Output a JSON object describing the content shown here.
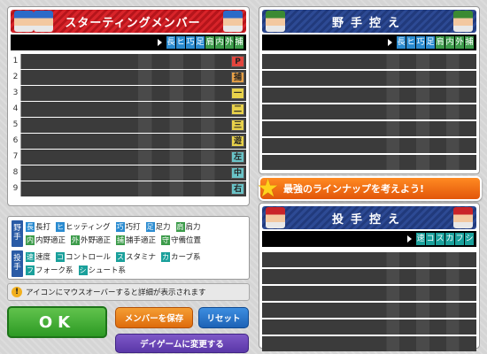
{
  "starting": {
    "title": "スターティングメンバー",
    "ability_icons": [
      {
        "label": "長",
        "color": "#2a8bd0"
      },
      {
        "label": "ヒ",
        "color": "#2a8bd0"
      },
      {
        "label": "巧",
        "color": "#2a8bd0"
      },
      {
        "label": "足",
        "color": "#2a8bd0"
      },
      {
        "label": "肩",
        "color": "#3c9b4a"
      },
      {
        "label": "内",
        "color": "#3c9b4a"
      },
      {
        "label": "外",
        "color": "#3c9b4a"
      },
      {
        "label": "捕",
        "color": "#3c9b4a"
      }
    ],
    "lineup": [
      {
        "num": "1",
        "pos": "P",
        "pos_color": "#e2453d"
      },
      {
        "num": "2",
        "pos": "捕",
        "pos_color": "#e7a046"
      },
      {
        "num": "3",
        "pos": "一",
        "pos_color": "#e8d14a"
      },
      {
        "num": "4",
        "pos": "二",
        "pos_color": "#e8d14a"
      },
      {
        "num": "5",
        "pos": "三",
        "pos_color": "#e8d14a"
      },
      {
        "num": "6",
        "pos": "遊",
        "pos_color": "#e8d14a"
      },
      {
        "num": "7",
        "pos": "左",
        "pos_color": "#69c3c7"
      },
      {
        "num": "8",
        "pos": "中",
        "pos_color": "#69c3c7"
      },
      {
        "num": "9",
        "pos": "右",
        "pos_color": "#69c3c7"
      }
    ]
  },
  "fielders_bench": {
    "title": "野手控え",
    "ability_icons": [
      {
        "label": "長",
        "color": "#2a8bd0"
      },
      {
        "label": "ヒ",
        "color": "#2a8bd0"
      },
      {
        "label": "巧",
        "color": "#2a8bd0"
      },
      {
        "label": "足",
        "color": "#2a8bd0"
      },
      {
        "label": "肩",
        "color": "#3c9b4a"
      },
      {
        "label": "内",
        "color": "#3c9b4a"
      },
      {
        "label": "外",
        "color": "#3c9b4a"
      },
      {
        "label": "捕",
        "color": "#3c9b4a"
      }
    ],
    "row_count": 7
  },
  "pitchers_bench": {
    "title": "投手控え",
    "ability_icons": [
      {
        "label": "速",
        "color": "#1aa09b"
      },
      {
        "label": "コ",
        "color": "#1aa09b"
      },
      {
        "label": "ス",
        "color": "#1aa09b"
      },
      {
        "label": "カ",
        "color": "#1aa09b"
      },
      {
        "label": "フ",
        "color": "#1aa09b"
      },
      {
        "label": "シ",
        "color": "#1aa09b"
      }
    ],
    "row_count": 6
  },
  "banner": {
    "text": "最強のラインナップを考えよう!"
  },
  "legend": {
    "fielder_tag": "野手",
    "pitcher_tag": "投手",
    "rows": [
      [
        {
          "icon": "長",
          "text": "長打",
          "color": "#2a8bd0"
        },
        {
          "icon": "ヒ",
          "text": "ヒッティング",
          "color": "#2a8bd0"
        },
        {
          "icon": "巧",
          "text": "巧打",
          "color": "#2a8bd0"
        },
        {
          "icon": "足",
          "text": "足力",
          "color": "#2a8bd0"
        },
        {
          "icon": "肩",
          "text": "肩力",
          "color": "#3c9b4a"
        }
      ],
      [
        {
          "icon": "内",
          "text": "内野適正",
          "color": "#3c9b4a"
        },
        {
          "icon": "外",
          "text": "外野適正",
          "color": "#3c9b4a"
        },
        {
          "icon": "捕",
          "text": "捕手適正",
          "color": "#3c9b4a"
        },
        {
          "icon": "守",
          "text": "守備位置",
          "color": "#3c9b4a"
        }
      ],
      [
        {
          "icon": "速",
          "text": "速度",
          "color": "#1aa09b"
        },
        {
          "icon": "コ",
          "text": "コントロール",
          "color": "#1aa09b"
        },
        {
          "icon": "ス",
          "text": "スタミナ",
          "color": "#1aa09b"
        },
        {
          "icon": "カ",
          "text": "カーブ系",
          "color": "#1aa09b"
        }
      ],
      [
        {
          "icon": "フ",
          "text": "フォーク系",
          "color": "#1aa09b"
        },
        {
          "icon": "シ",
          "text": "シュート系",
          "color": "#1aa09b"
        }
      ]
    ]
  },
  "notice": {
    "text": "アイコンにマウスオーバーすると詳細が表示されます",
    "icon": "!"
  },
  "buttons": {
    "ok": "OK",
    "save": "メンバーを保存",
    "reset": "リセット",
    "day_game": "デイゲームに変更する"
  }
}
